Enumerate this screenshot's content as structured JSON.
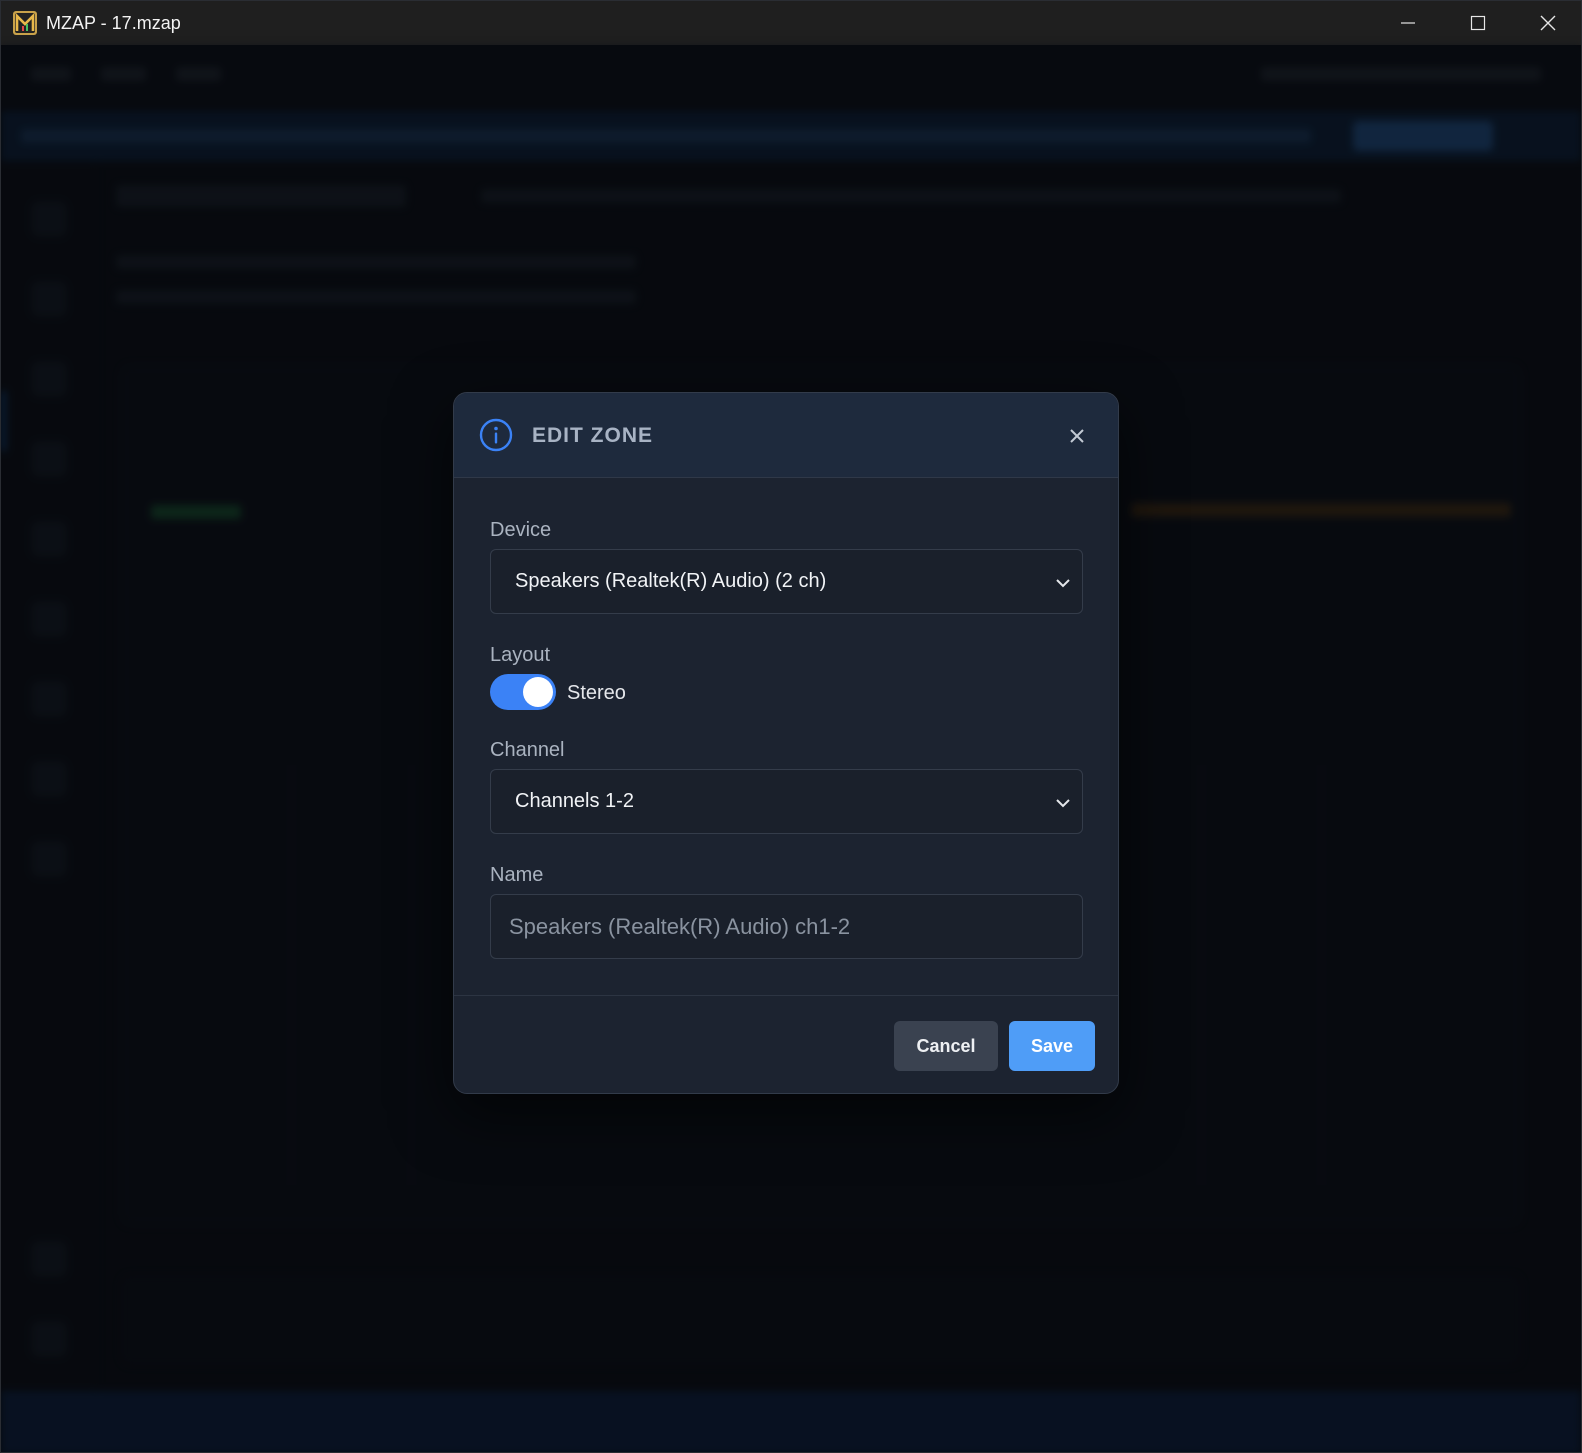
{
  "window": {
    "title": "MZAP - 17.mzap",
    "controls": {
      "minimize": "minimize-icon",
      "maximize": "maximize-icon",
      "close": "close-icon"
    }
  },
  "dialog": {
    "title": "EDIT ZONE",
    "icon": "info-icon",
    "device": {
      "label": "Device",
      "selected": "Speakers (Realtek(R) Audio) (2 ch)"
    },
    "layout": {
      "label": "Layout",
      "toggle_on": true,
      "toggle_label": "Stereo"
    },
    "channel": {
      "label": "Channel",
      "selected": "Channels 1-2"
    },
    "name": {
      "label": "Name",
      "placeholder": "Speakers (Realtek(R) Audio) ch1-2",
      "value": ""
    },
    "buttons": {
      "cancel": "Cancel",
      "save": "Save"
    }
  },
  "colors": {
    "accent": "#3b82f6",
    "save_button": "#4f9df7",
    "modal_bg": "#1c2330",
    "header_bg": "#1e2a3d"
  }
}
